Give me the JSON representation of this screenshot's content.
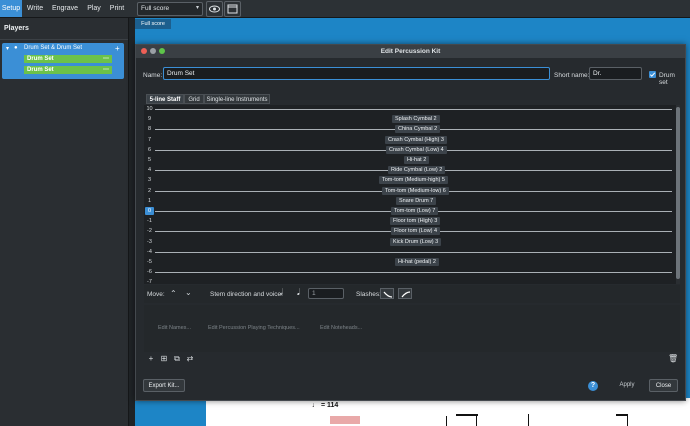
{
  "toolbar": {
    "modes": [
      "Setup",
      "Write",
      "Engrave",
      "Play",
      "Print"
    ],
    "layout_select": "Full score"
  },
  "left_panel": {
    "title": "Players",
    "player": {
      "name": "Drum Set & Drum Set",
      "instruments": [
        "Drum Set",
        "Drum Set"
      ]
    }
  },
  "score": {
    "tab": "Full score",
    "tempo": "♩ = 114"
  },
  "dialog": {
    "title": "Edit Percussion Kit",
    "name_label": "Name:",
    "name_value": "Drum Set",
    "short_name_label": "Short name:",
    "short_name_value": "Dr.",
    "checkbox_label": "Drum set",
    "checkbox_checked": true,
    "view_tabs": [
      "5-line Staff",
      "Grid",
      "Single-line Instruments"
    ],
    "active_tab": "5-line Staff",
    "staff_positions": [
      "10",
      "9",
      "8",
      "7",
      "6",
      "5",
      "4",
      "3",
      "2",
      "1",
      "0",
      "-1",
      "-2",
      "-3",
      "-4",
      "-5",
      "-6",
      "-7"
    ],
    "selected_position": "0",
    "instruments": [
      {
        "pos": "9",
        "label": "Splash Cymbal 2"
      },
      {
        "pos": "8",
        "label": "China Cymbal 2"
      },
      {
        "pos": "7",
        "label": "Crash Cymbal (High) 3"
      },
      {
        "pos": "6",
        "label": "Crash Cymbal (Low) 4"
      },
      {
        "pos": "5",
        "label": "Hi-hat 2"
      },
      {
        "pos": "4",
        "label": "Ride Cymbal (Low) 2"
      },
      {
        "pos": "3",
        "label": "Tom-tom (Medium-high) 5"
      },
      {
        "pos": "2",
        "label": "Tom-tom (Medium-low) 6"
      },
      {
        "pos": "1",
        "label": "Snare Drum 7"
      },
      {
        "pos": "0",
        "label": "Tom-tom (Low) 7"
      },
      {
        "pos": "-1",
        "label": "Floor tom (High) 3"
      },
      {
        "pos": "-2",
        "label": "Floor tom (Low) 4"
      },
      {
        "pos": "-3",
        "label": "Kick Drum (Low) 3"
      },
      {
        "pos": "-5",
        "label": "Hi-hat (pedal) 2"
      }
    ],
    "move_label": "Move:",
    "stem_label": "Stem direction and voice:",
    "voice_value": "1",
    "slashes_label": "Slashes:",
    "edit_buttons": [
      "Edit Names...",
      "Edit Percussion Playing Techniques...",
      "Edit Noteheads..."
    ],
    "export_button": "Export Kit...",
    "help_button": "?",
    "apply_button": "Apply",
    "close_button": "Close"
  },
  "colors": {
    "accent": "#3b8fd6",
    "instrument_green": "#6cc24a",
    "score_blue": "#1d85c6"
  }
}
